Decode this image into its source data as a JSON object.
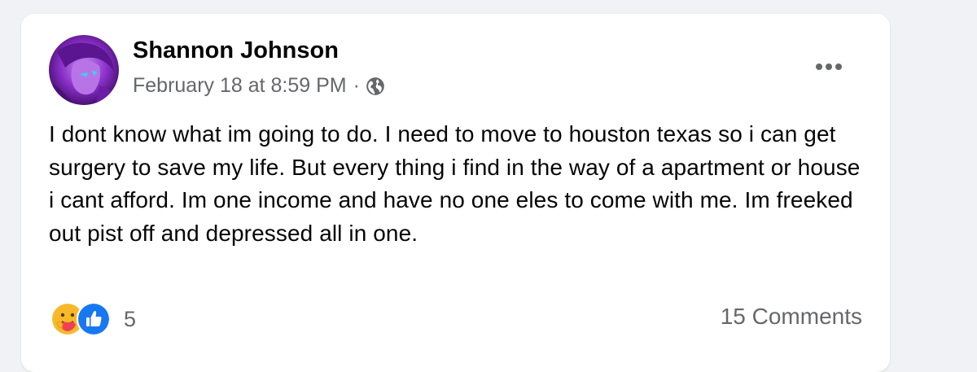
{
  "post": {
    "author": "Shannon Johnson",
    "timestamp": "February 18 at 8:59 PM",
    "separator": "·",
    "privacy_icon": "globe-icon",
    "text": "I dont know what im going to do. I need to move to houston texas so i can get surgery to save my life. But every thing i find in the way of a apartment or house i cant afford. Im one income and have no one eles to come with me. Im freeked out pist off and depressed all in one.",
    "more_icon": "more-options-icon"
  },
  "reactions": {
    "icons": [
      "care-reaction-icon",
      "like-reaction-icon"
    ],
    "count": "5"
  },
  "comments": {
    "label": "15 Comments"
  },
  "colors": {
    "background": "#f0f2f5",
    "card": "#ffffff",
    "text_primary": "#050505",
    "text_secondary": "#65676b",
    "like_blue": "#1877f2",
    "care_yellow": "#f7b928"
  }
}
